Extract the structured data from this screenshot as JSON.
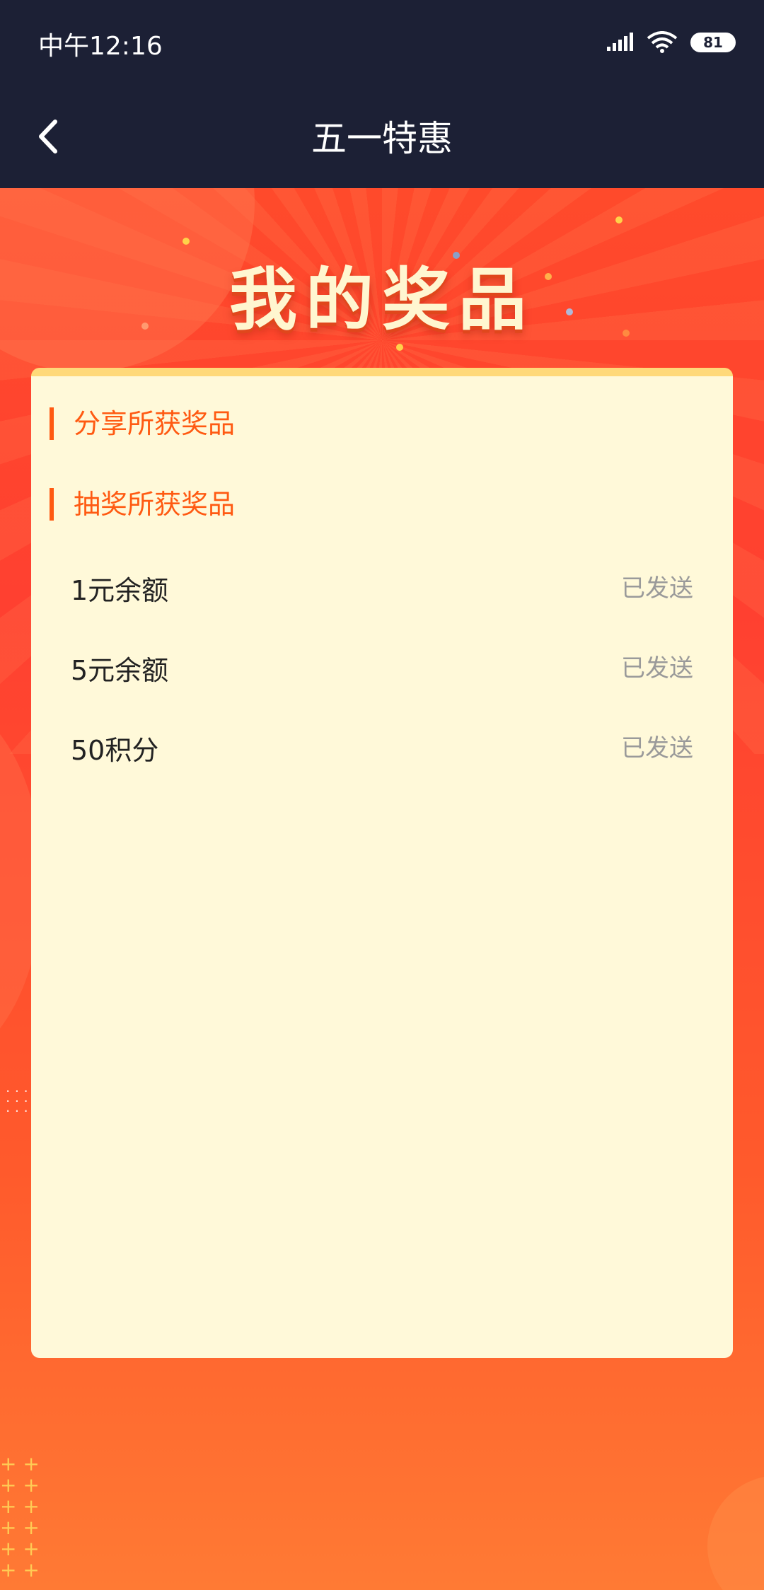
{
  "status_bar": {
    "time": "中午12:16",
    "battery": "81"
  },
  "nav": {
    "title": "五一特惠"
  },
  "hero": {
    "heading": "我的奖品"
  },
  "sections": {
    "share": "分享所获奖品",
    "lottery": "抽奖所获奖品"
  },
  "prizes": [
    {
      "name": "1元余额",
      "status": "已发送"
    },
    {
      "name": "5元余额",
      "status": "已发送"
    },
    {
      "name": "50积分",
      "status": "已发送"
    }
  ],
  "colors": {
    "nav_bg": "#1c2035",
    "accent": "#ff5a12",
    "card_bg": "#fff9d9"
  }
}
